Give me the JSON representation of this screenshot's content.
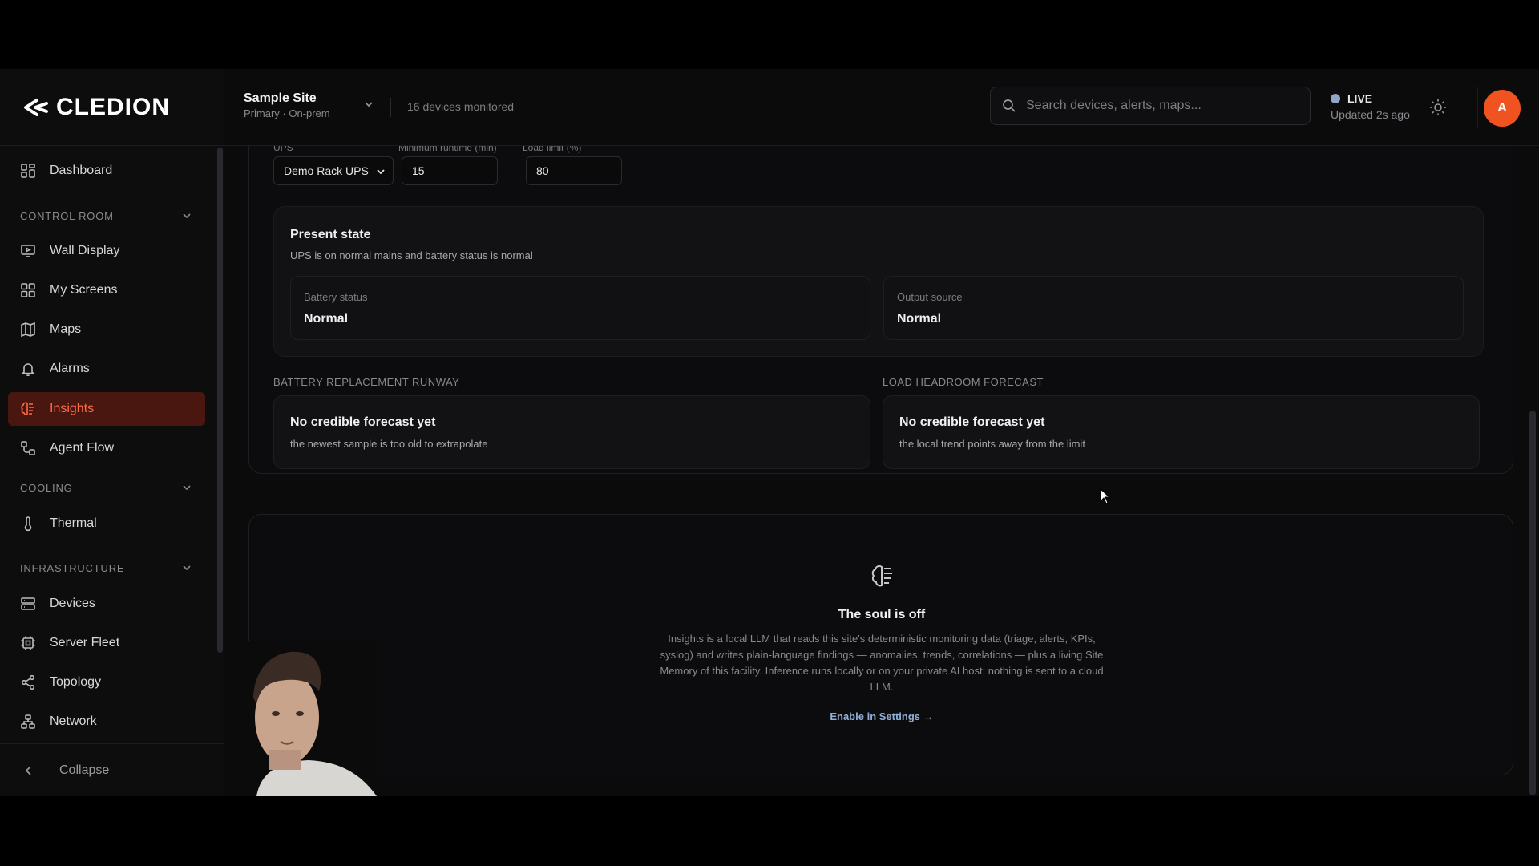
{
  "brand": {
    "name": "CLEDION"
  },
  "header": {
    "site_name": "Sample Site",
    "site_sub": "Primary · On-prem",
    "devices_count": "16 devices monitored",
    "search_placeholder": "Search devices, alerts, maps...",
    "live_label": "LIVE",
    "live_updated": "Updated 2s ago",
    "avatar_initial": "A"
  },
  "sidebar": {
    "items": {
      "dashboard": "Dashboard",
      "wall_display": "Wall Display",
      "my_screens": "My Screens",
      "maps": "Maps",
      "alarms": "Alarms",
      "insights": "Insights",
      "agent_flow": "Agent Flow",
      "thermal": "Thermal",
      "devices": "Devices",
      "server_fleet": "Server Fleet",
      "topology": "Topology",
      "network": "Network"
    },
    "sections": {
      "control_room": "CONTROL ROOM",
      "cooling": "COOLING",
      "infrastructure": "INFRASTRUCTURE"
    },
    "active": "insights",
    "collapse_label": "Collapse"
  },
  "ups": {
    "labels": {
      "ups": "UPS",
      "min_runtime": "Minimum runtime (min)",
      "load_limit": "Load limit (%)"
    },
    "selected_ups": "Demo Rack UPS",
    "min_runtime": "15",
    "load_limit": "80",
    "present_state": {
      "title": "Present state",
      "description": "UPS is on normal mains and battery status is normal",
      "battery_status_label": "Battery status",
      "battery_status_value": "Normal",
      "output_source_label": "Output source",
      "output_source_value": "Normal"
    },
    "battery_runway": {
      "heading": "BATTERY REPLACEMENT RUNWAY",
      "title": "No credible forecast yet",
      "description": "the newest sample is too old to extrapolate"
    },
    "load_headroom": {
      "heading": "LOAD HEADROOM FORECAST",
      "title": "No credible forecast yet",
      "description": "the local trend points away from the limit"
    }
  },
  "soul": {
    "title": "The soul is off",
    "description": "Insights is a local LLM that reads this site's deterministic monitoring data (triage, alerts, KPIs, syslog) and writes plain-language findings — anomalies, trends, correlations — plus a living Site Memory of this facility. Inference runs locally or on your private AI host; nothing is sent to a cloud LLM.",
    "link": "Enable in Settings →"
  },
  "colors": {
    "accent": "#f0531f",
    "active_bg": "#4a1710",
    "active_fg": "#ff6a45",
    "link": "#8fb0d8",
    "live_dot": "#8fa6c8"
  }
}
